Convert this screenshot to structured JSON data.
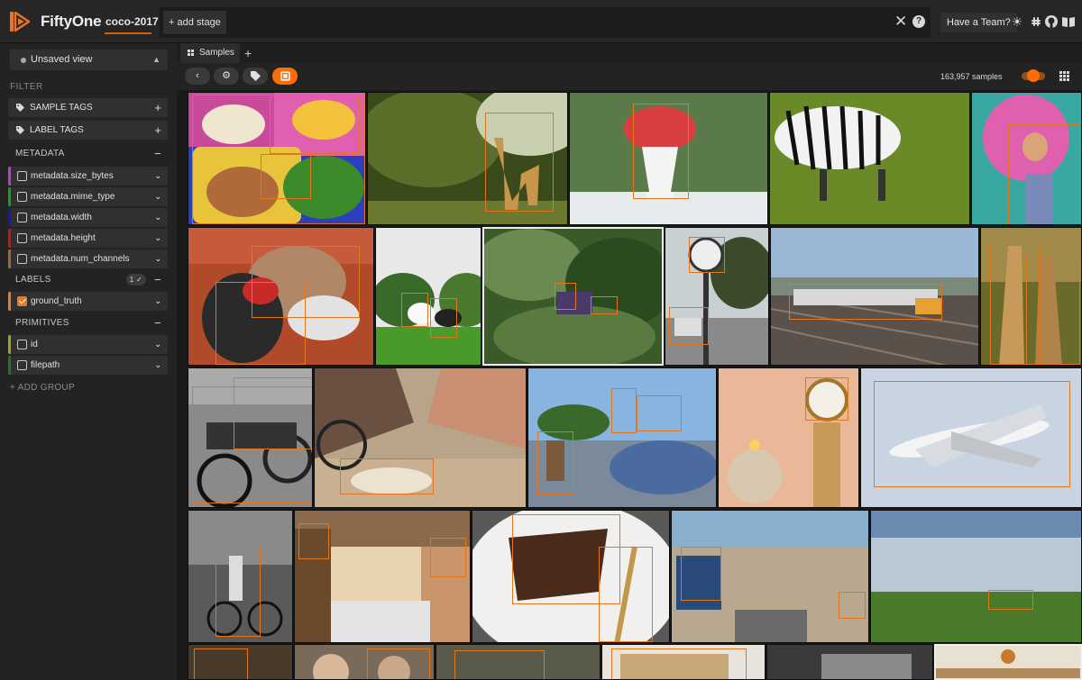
{
  "header": {
    "brand": "FiftyOne",
    "dataset_name": "coco-2017",
    "add_stage_label": "+ add stage",
    "team_button": "Have a Team?",
    "icons": [
      "close-icon",
      "help-icon",
      "light-mode-icon",
      "slack-icon",
      "github-icon",
      "docs-icon"
    ]
  },
  "sidebar": {
    "view_selector": "Unsaved view",
    "filter_label": "FILTER",
    "tag_rows": [
      {
        "label": "SAMPLE TAGS"
      },
      {
        "label": "LABEL TAGS"
      }
    ],
    "metadata_section": "METADATA",
    "metadata_fields": [
      {
        "label": "metadata.size_bytes",
        "color": "#c13bd2"
      },
      {
        "label": "metadata.mime_type",
        "color": "#17a317"
      },
      {
        "label": "metadata.width",
        "color": "#1818b8"
      },
      {
        "label": "metadata.height",
        "color": "#d0121b"
      },
      {
        "label": "metadata.num_channels",
        "color": "#a06a2c"
      }
    ],
    "labels_section": "LABELS",
    "labels_badge": "1 ✓",
    "label_fields": [
      {
        "label": "ground_truth",
        "color": "#e87b2a",
        "checked": true
      }
    ],
    "primitives_section": "PRIMITIVES",
    "primitive_fields": [
      {
        "label": "id",
        "color": "#a4a41a"
      },
      {
        "label": "filepath",
        "color": "#1a7a2a"
      }
    ],
    "add_group": "+ ADD GROUP"
  },
  "tabs": [
    {
      "label": "Samples"
    }
  ],
  "toolbar": {
    "sample_count": "163,957 samples",
    "accent": "#ff6d04"
  }
}
